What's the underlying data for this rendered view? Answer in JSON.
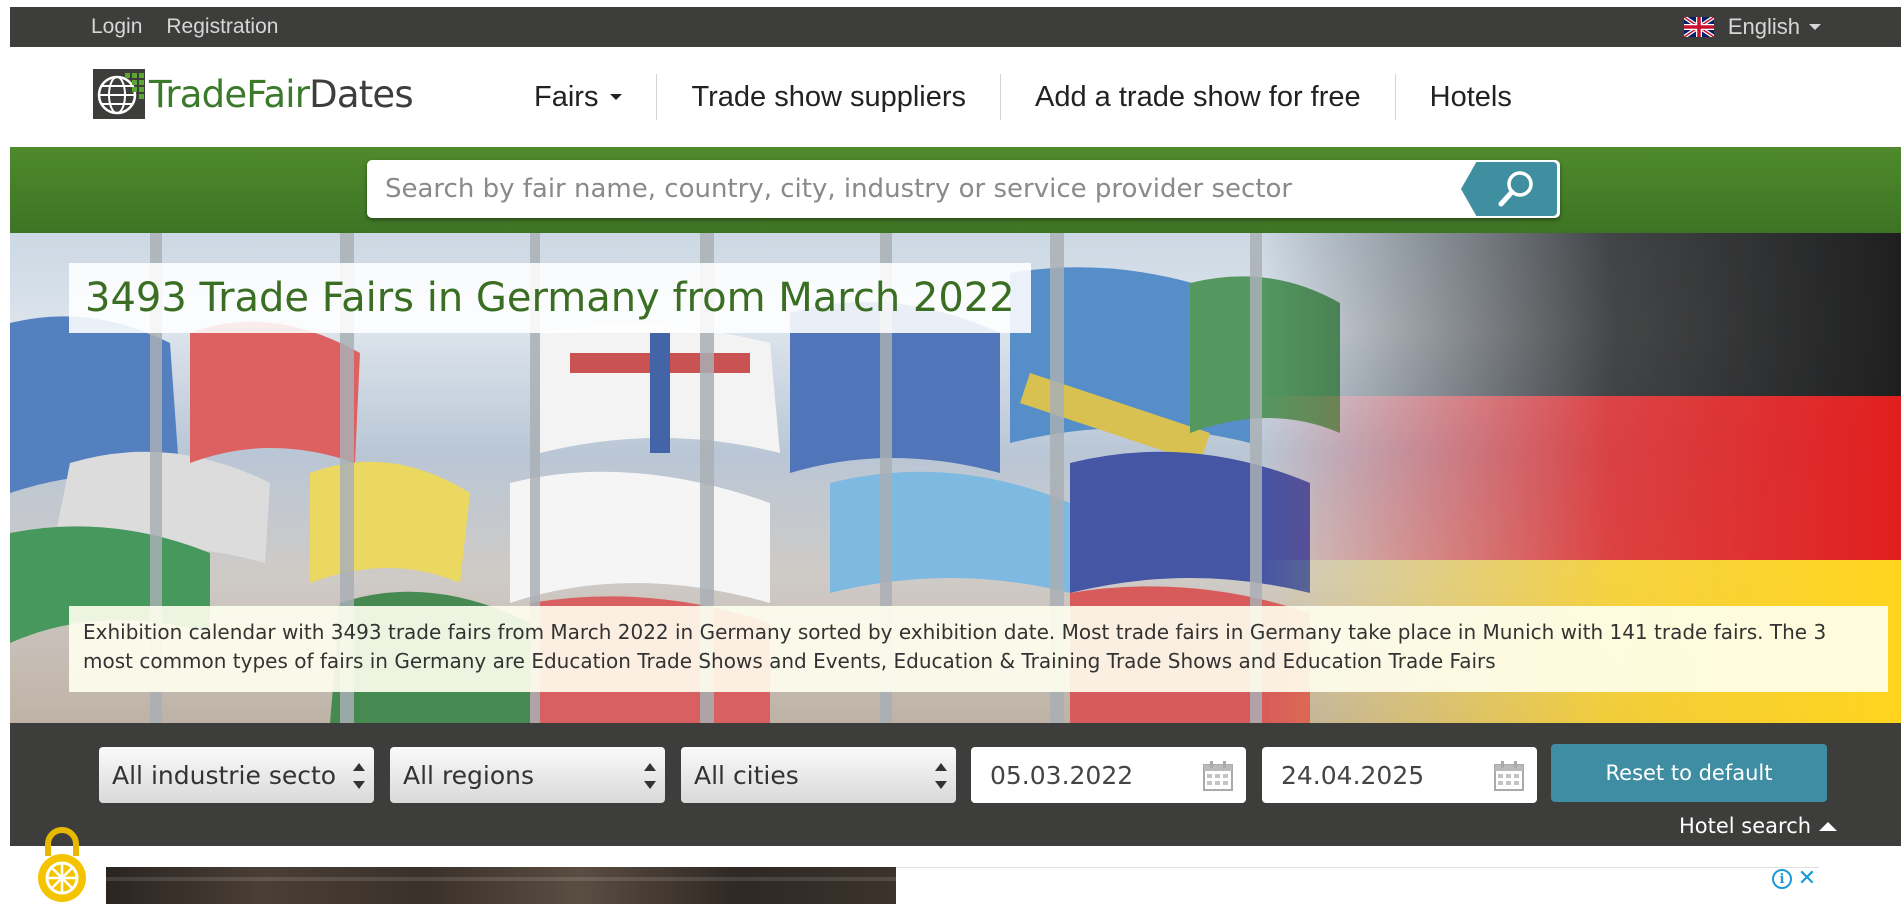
{
  "topbar": {
    "login": "Login",
    "registration": "Registration",
    "language": "English",
    "language_flag_icon": "uk-flag-icon"
  },
  "brand": {
    "name_green": "TradeFair",
    "name_dark": "Dates"
  },
  "nav": {
    "items": [
      {
        "label": "Fairs",
        "has_dropdown": true
      },
      {
        "label": "Trade show suppliers"
      },
      {
        "label": "Add a trade show for free"
      },
      {
        "label": "Hotels"
      }
    ]
  },
  "search": {
    "placeholder": "Search by fair name, country, city, industry or service provider sector",
    "value": ""
  },
  "hero": {
    "title": "3493 Trade Fairs in Germany from March 2022",
    "description": "Exhibition calendar with 3493 trade fairs from March 2022 in Germany sorted by exhibition date. Most trade fairs in Germany take place in Munich with 141 trade fairs. The 3 most common types of fairs in Germany are Education Trade Shows and Events, Education & Training Trade Shows and Education Trade Fairs"
  },
  "filters": {
    "industry": "All industrie sectors",
    "region": "All regions",
    "city": "All cities",
    "date_from": "05.03.2022",
    "date_to": "24.04.2025",
    "reset_label": "Reset to default",
    "hotel_search_label": "Hotel search"
  },
  "colors": {
    "topbar": "#3d3e3c",
    "brand_green": "#3a7a2a",
    "search_band": "#46802a",
    "accent_teal": "#3e8da2",
    "germany_black": "#000000",
    "germany_red": "#dd0000",
    "germany_gold": "#ffce00"
  }
}
